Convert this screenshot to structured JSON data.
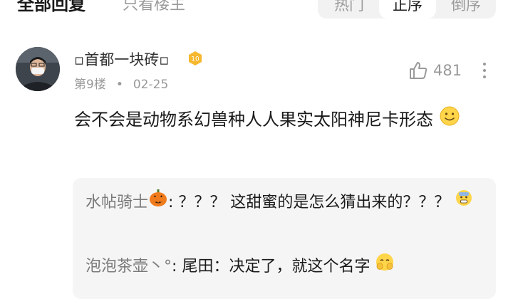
{
  "header": {
    "all_replies": "全部回复",
    "only_op": "只看楼主",
    "sort": {
      "hot": "热门",
      "asc": "正序",
      "desc": "倒序",
      "selected": "正序"
    }
  },
  "comment": {
    "username": "▫首都一块砖▫",
    "level": "10",
    "floor": "第9楼",
    "separator": "•",
    "date": "02-25",
    "likes": "481",
    "text": "会不会是动物系幻兽种人人果实太阳神尼卡形态",
    "text_emoji": "smile-emoji"
  },
  "replies": [
    {
      "name": "水帖骑士",
      "name_emoji": "pumpkin-emoji",
      "colon": ":",
      "text": "？？？ 这甜蜜的是怎么猜出来的？？？",
      "trail_emoji": "fearful-emoji"
    },
    {
      "name": "泡泡茶壶丶°",
      "colon": ":",
      "text": "尾田：决定了，就这个名字",
      "trail_emoji": "shy-emoji"
    }
  ],
  "colors": {
    "accent_gold": "#f5b82e",
    "pumpkin": "#f07c1e",
    "muted": "#999999"
  }
}
